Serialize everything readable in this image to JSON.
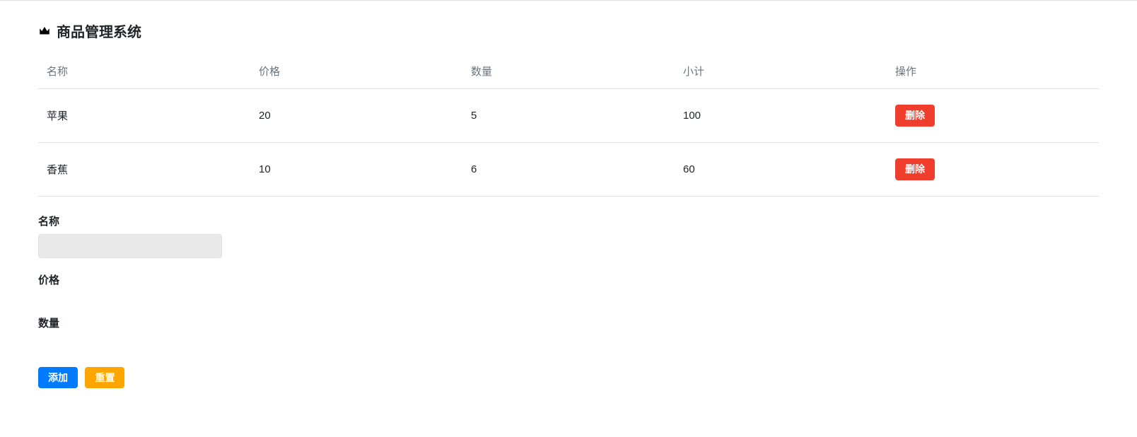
{
  "title": "商品管理系统",
  "table": {
    "headers": {
      "name": "名称",
      "price": "价格",
      "quantity": "数量",
      "subtotal": "小计",
      "action": "操作"
    },
    "deleteLabel": "删除",
    "rows": [
      {
        "name": "苹果",
        "price": "20",
        "quantity": "5",
        "subtotal": "100"
      },
      {
        "name": "香蕉",
        "price": "10",
        "quantity": "6",
        "subtotal": "60"
      }
    ]
  },
  "form": {
    "nameLabel": "名称",
    "priceLabel": "价格",
    "quantityLabel": "数量",
    "nameValue": "",
    "priceValue": "",
    "quantityValue": "",
    "addLabel": "添加",
    "resetLabel": "重置"
  }
}
